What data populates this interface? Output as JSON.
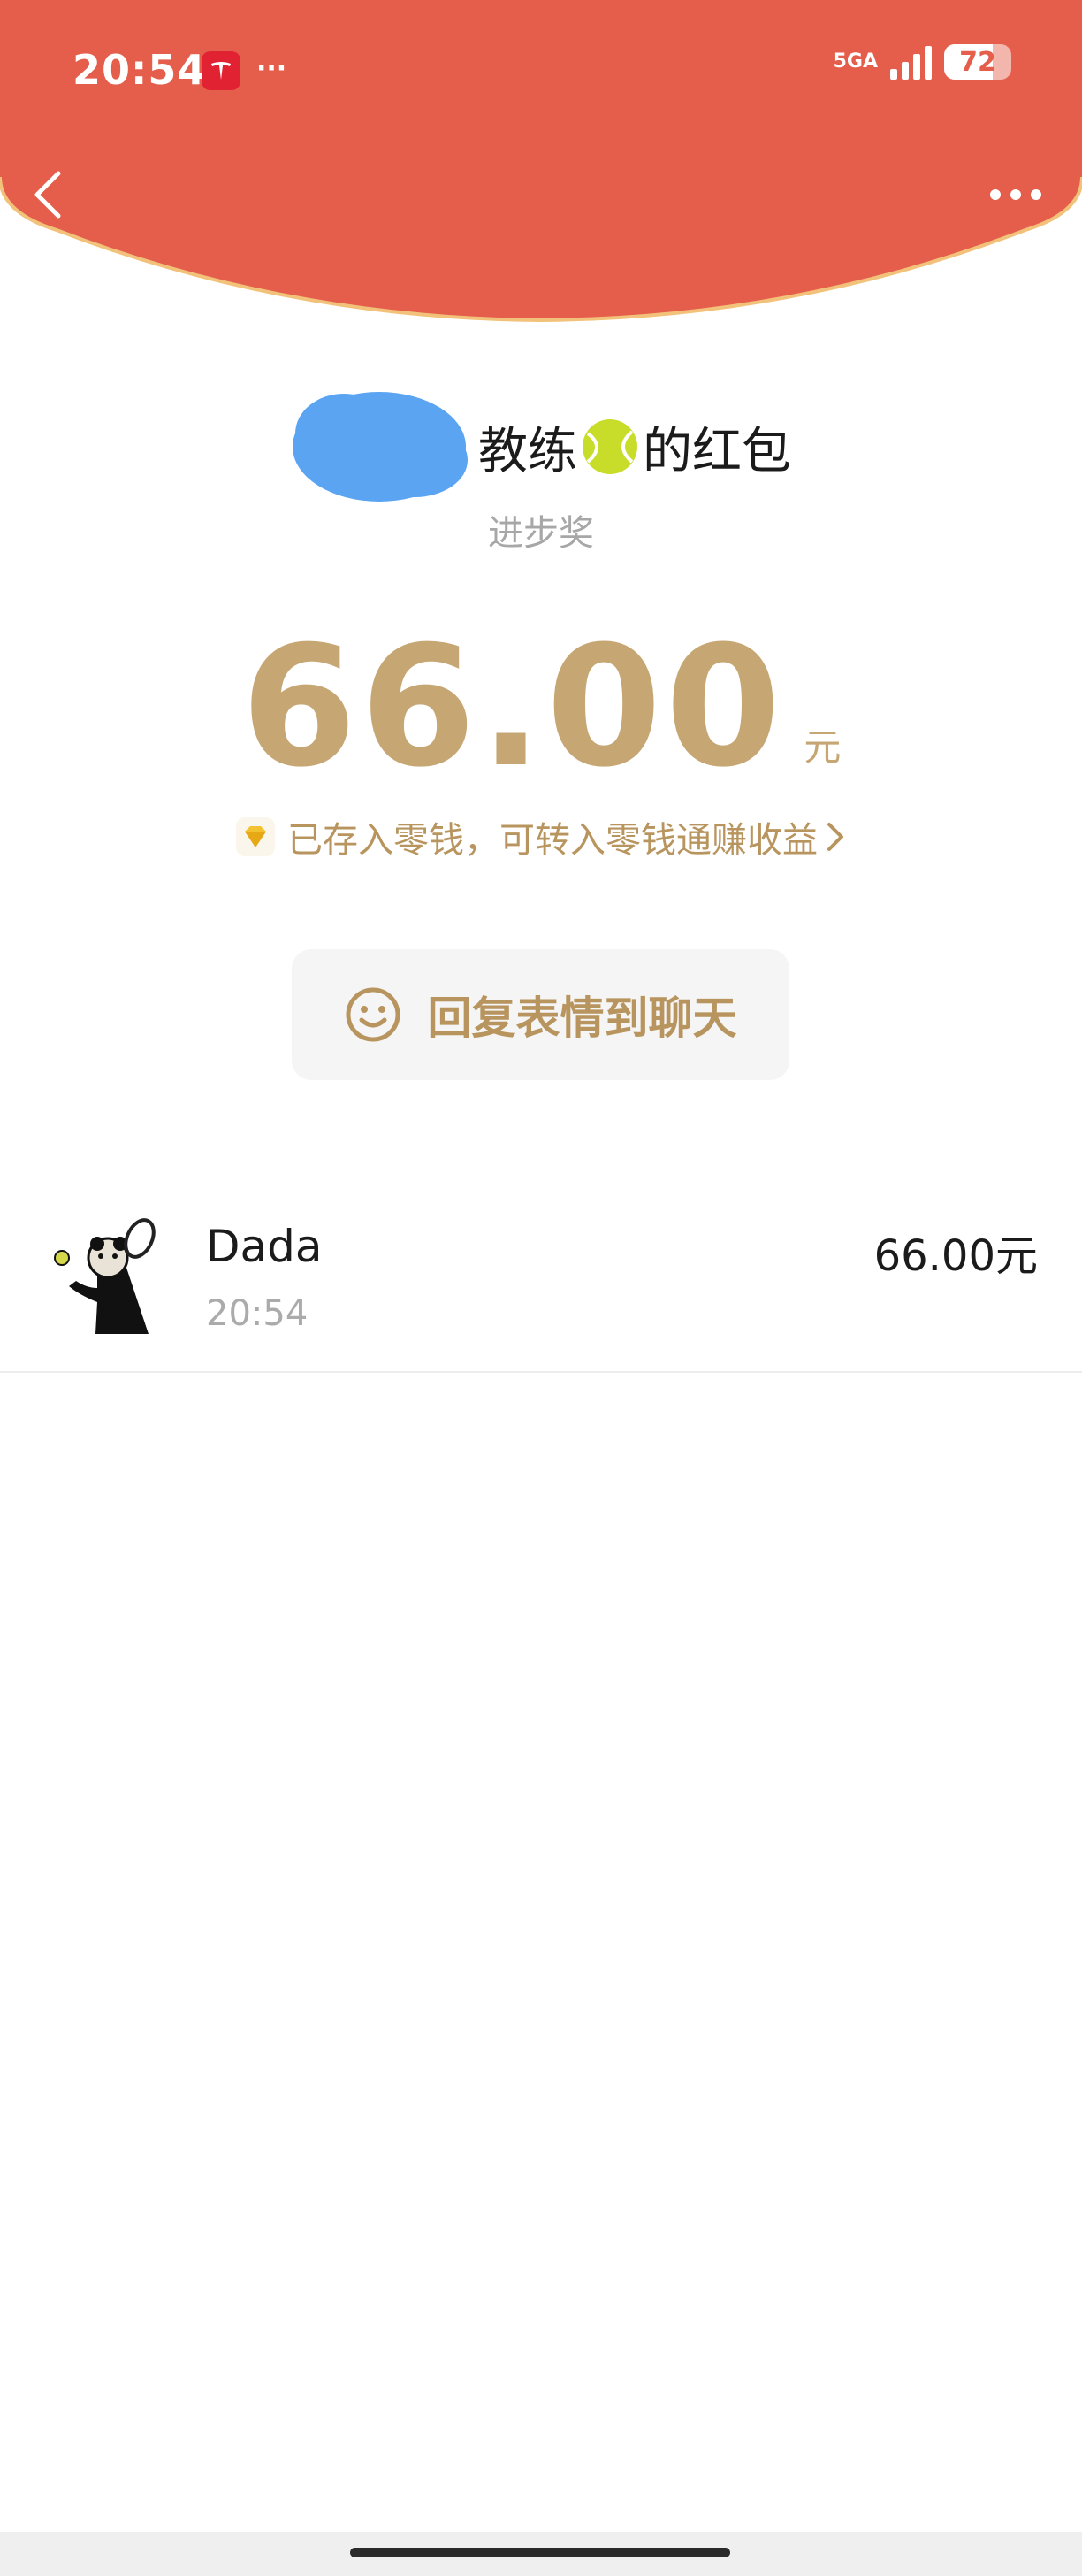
{
  "status_bar": {
    "time": "20:54",
    "dots": "···",
    "network": "5GA",
    "battery": "72",
    "battery_level": 0.72
  },
  "colors": {
    "header_red": "#e55d4b",
    "gold": "#c6a774",
    "gold_text": "#b8955e"
  },
  "envelope": {
    "sender_suffix": "教练",
    "title_tail": "的红包",
    "subtitle": "进步奖",
    "amount": "66.00",
    "currency": "元",
    "note": "已存入零钱，可转入零钱通赚收益",
    "reply_label": "回复表情到聊天"
  },
  "receivers": [
    {
      "name": "Dada",
      "time": "20:54",
      "amount": "66.00元"
    }
  ],
  "icons": {
    "back": "chevron-left-icon",
    "more": "more-horizontal-icon",
    "gem": "diamond-icon",
    "smile": "smile-icon",
    "ball": "tennis-ball-icon"
  }
}
